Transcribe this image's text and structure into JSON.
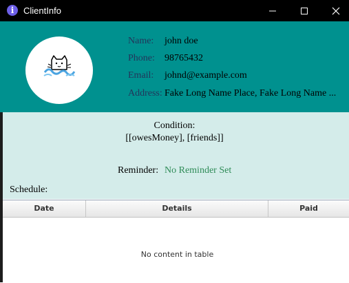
{
  "window": {
    "title": "ClientInfo",
    "icon": "info-icon"
  },
  "client": {
    "name_label": "Name:",
    "name": "john doe",
    "phone_label": "Phone:",
    "phone": "98765432",
    "email_label": "Email:",
    "email": "johnd@example.com",
    "address_label": "Address:",
    "address": "Fake Long Name Place, Fake Long Name ..."
  },
  "condition": {
    "label": "Condition:",
    "value": "[[owesMoney], [friends]]"
  },
  "reminder": {
    "label": "Reminder:",
    "value": "No Reminder Set"
  },
  "schedule": {
    "label": "Schedule:",
    "columns": [
      "Date",
      "Details",
      "Paid"
    ],
    "empty_message": "No content in table"
  },
  "colors": {
    "header_bg": "#00918f",
    "mid_bg": "#d4ecea",
    "reminder_text": "#2e8b57"
  }
}
